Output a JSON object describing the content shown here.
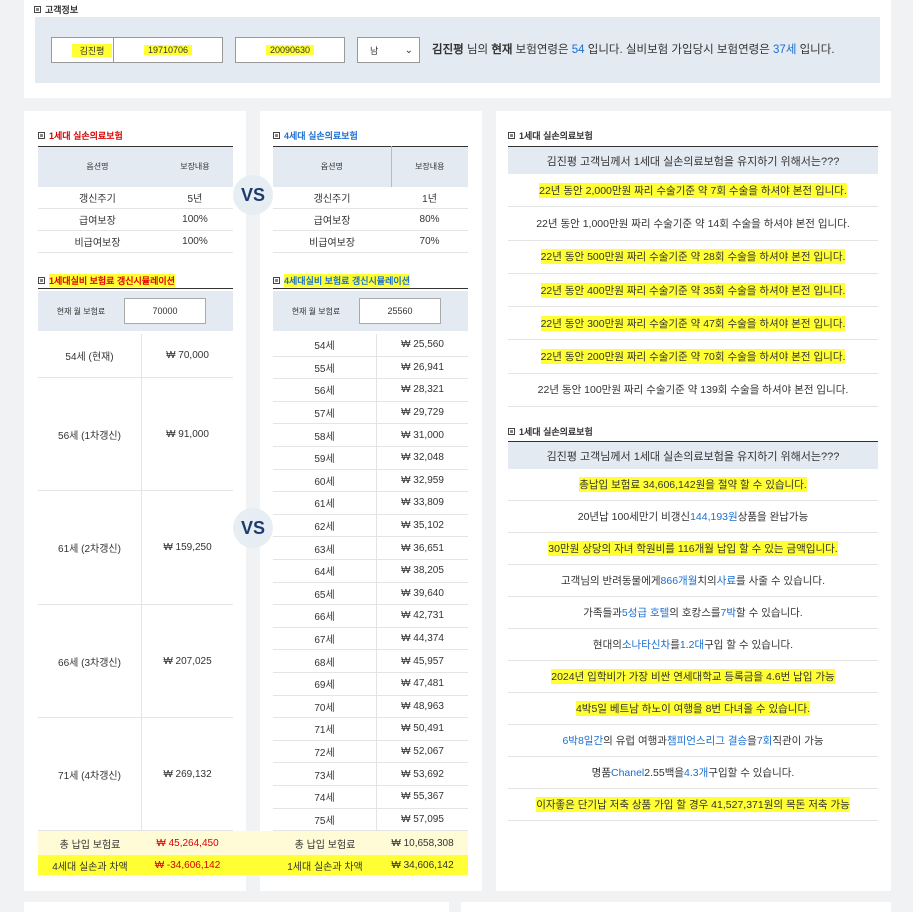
{
  "header": {
    "section_title": "고객정보"
  },
  "customer": {
    "name": "김진평",
    "birth": "19710706",
    "join_date": "20090630",
    "gender": "남",
    "sentence": {
      "name": "김진평",
      "part1": " 님의 ",
      "now": "현재",
      "part2": " 보험연령은 ",
      "age": "54",
      "part3": " 입니다. 실비보험 가입당시 보험연령은 ",
      "join_age": "37세",
      "part4": " 입니다."
    }
  },
  "gen1": {
    "title": "1세대 실손의료보험",
    "col1": "옵션명",
    "col2": "보장내용",
    "rows": [
      {
        "opt": "갱신주기",
        "val": "5년"
      },
      {
        "opt": "급여보장",
        "val": "100%"
      },
      {
        "opt": "비급여보장",
        "val": "100%"
      }
    ],
    "sim_title": "1세대실비 보험료 갱신시뮬레이션",
    "cur_label": "현재 월 보험료",
    "cur_value": "70000",
    "ages": [
      {
        "age": "54세 (현재)",
        "price": "₩ 70,000"
      },
      {
        "age": "56세 (1차갱신)",
        "price": "₩ 91,000"
      },
      {
        "age": "61세 (2차갱신)",
        "price": "₩ 159,250"
      },
      {
        "age": "66세 (3차갱신)",
        "price": "₩ 207,025"
      },
      {
        "age": "71세 (4차갱신)",
        "price": "₩ 269,132"
      }
    ],
    "total_label": "총 납입 보험료",
    "total_value": "₩ 45,264,450",
    "diff_label": "4세대 실손과 차액",
    "diff_value": "₩ -34,606,142"
  },
  "gen4": {
    "title": "4세대 실손의료보험",
    "col1": "옵션명",
    "col2": "보장내용",
    "rows": [
      {
        "opt": "갱신주기",
        "val": "1년"
      },
      {
        "opt": "급여보장",
        "val": "80%"
      },
      {
        "opt": "비급여보장",
        "val": "70%"
      }
    ],
    "sim_title": "4세대실비 보험료 갱신시뮬레이션",
    "cur_label": "현재 월 보험료",
    "cur_value": "25560",
    "ages": [
      {
        "age": "54세",
        "price": "₩ 25,560"
      },
      {
        "age": "55세",
        "price": "₩ 26,941"
      },
      {
        "age": "56세",
        "price": "₩ 28,321"
      },
      {
        "age": "57세",
        "price": "₩ 29,729"
      },
      {
        "age": "58세",
        "price": "₩ 31,000"
      },
      {
        "age": "59세",
        "price": "₩ 32,048"
      },
      {
        "age": "60세",
        "price": "₩ 32,959"
      },
      {
        "age": "61세",
        "price": "₩ 33,809"
      },
      {
        "age": "62세",
        "price": "₩ 35,102"
      },
      {
        "age": "63세",
        "price": "₩ 36,651"
      },
      {
        "age": "64세",
        "price": "₩ 38,205"
      },
      {
        "age": "65세",
        "price": "₩ 39,640"
      },
      {
        "age": "66세",
        "price": "₩ 42,731"
      },
      {
        "age": "67세",
        "price": "₩ 44,374"
      },
      {
        "age": "68세",
        "price": "₩ 45,957"
      },
      {
        "age": "69세",
        "price": "₩ 47,481"
      },
      {
        "age": "70세",
        "price": "₩ 48,963"
      },
      {
        "age": "71세",
        "price": "₩ 50,491"
      },
      {
        "age": "72세",
        "price": "₩ 52,067"
      },
      {
        "age": "73세",
        "price": "₩ 53,692"
      },
      {
        "age": "74세",
        "price": "₩ 55,367"
      },
      {
        "age": "75세",
        "price": "₩ 57,095"
      }
    ],
    "total_label": "총 납입 보험료",
    "total_value": "₩ 10,658,308",
    "diff_label": "1세대 실손과 차액",
    "diff_value": "₩ 34,606,142"
  },
  "vs": "VS",
  "right1": {
    "title": "1세대 실손의료보험",
    "header": "김진평 고객님께서 1세대 실손의료보험을 유지하기 위해서는???",
    "rows": [
      "22년 동안 2,000만원 짜리 수술기준 약 7회 수술을 하셔야 본전 입니다.",
      "22년 동안 1,000만원 짜리 수술기준 약 14회 수술을 하셔야 본전 입니다.",
      "22년 동안 500만원 짜리 수술기준 약 28회 수술을 하셔야 본전 입니다.",
      "22년 동안 400만원 짜리 수술기준 약 35회 수술을 하셔야 본전 입니다.",
      "22년 동안 300만원 짜리 수술기준 약 47회 수술을 하셔야 본전 입니다.",
      "22년 동안 200만원 짜리 수술기준 약 70회 수술을 하셔야 본전 입니다.",
      "22년 동안 100만원 짜리 수술기준 약 139회 수술을 하셔야 본전 입니다."
    ]
  },
  "right2": {
    "title": "1세대 실손의료보험",
    "header": "김진평 고객님께서 1세대 실손의료보험을 유지하기 위해서는???",
    "r1": "총납입 보험료 34,606,142원을 절약 할 수 있습니다.",
    "r2": {
      "a": "20년납 100세만기 비갱신 ",
      "b": "144,193원",
      "c": " 상품을 완납가능"
    },
    "r3": "30만원 상당의 자녀 학원비를 116개월 납입 할 수 있는 금액입니다.",
    "r4": {
      "a": "고객님의 반려동물에게 ",
      "b": "866개월",
      "c": "치의 ",
      "d": "사료",
      "e": "를 사줄 수 있습니다."
    },
    "r5": {
      "a": "가족들과 ",
      "b": "5성급 호텔",
      "c": "의 호캉스를 ",
      "d": "7박",
      "e": " 할 수 있습니다."
    },
    "r6": {
      "a": "현대의 ",
      "b": "소나타신차",
      "c": "를 ",
      "d": "1.2대",
      "e": " 구입 할 수 있습니다."
    },
    "r7": "2024년 입학비가 가장 비싼 연세대학교 등록금을 4.6번 납입 가능",
    "r8": "4박5일 베트남 하노이 여행을 8번 다녀올 수 있습니다.",
    "r9": {
      "a": "6박8일간",
      "b": "의 유럽 여행과 ",
      "c": "챔피언스리그 결승",
      "d": "을 ",
      "e": "7회",
      "f": " 직관이 가능"
    },
    "r10": {
      "a": "명품 ",
      "b": "Chanel",
      "c": " 2.55백을 ",
      "d": "4.3개",
      "e": " 구입할 수 있습니다."
    },
    "r11": "이자좋은 단기납 저축 상품 가입 할 경우 41,527,371원의 목돈 저축 가능"
  }
}
